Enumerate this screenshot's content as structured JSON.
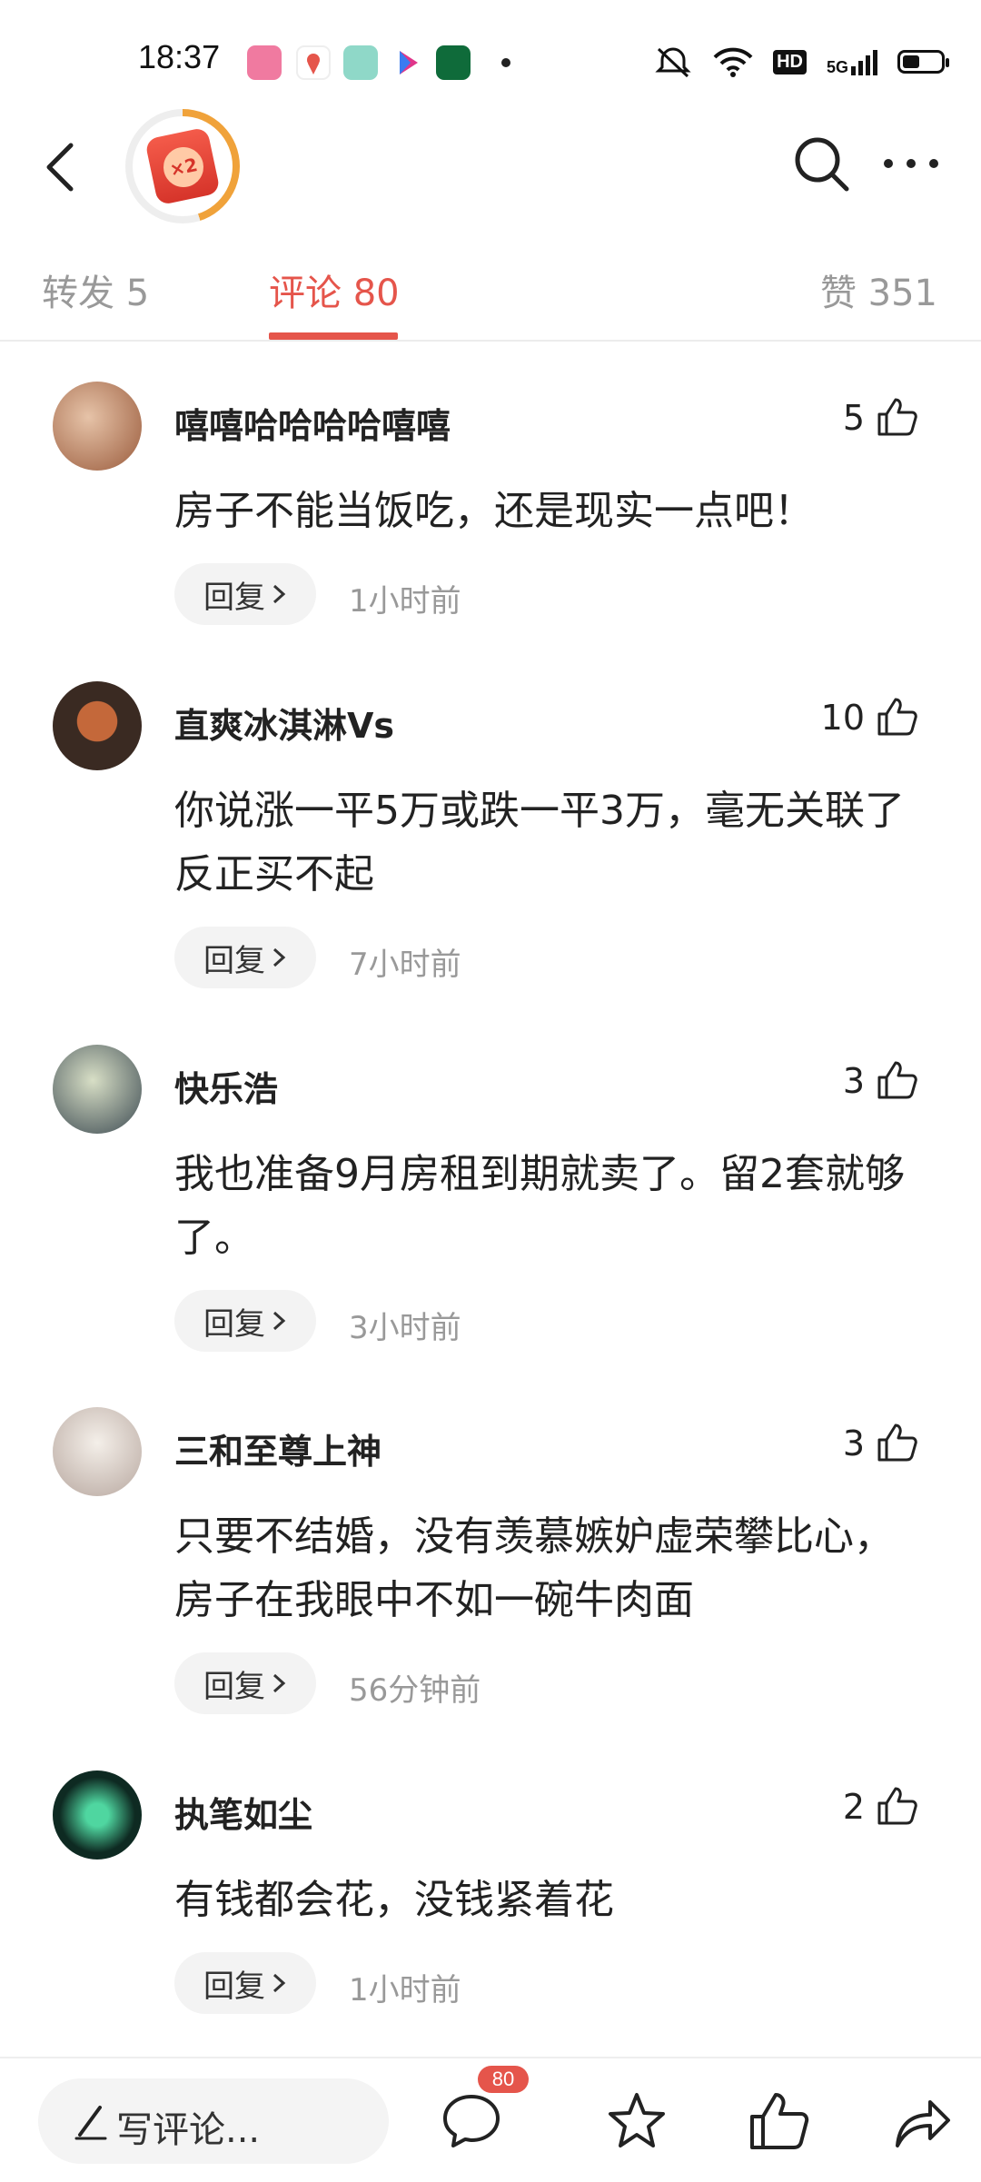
{
  "status_bar": {
    "time": "18:37",
    "hd": "HD",
    "network": "5G",
    "battery_level": 0.45
  },
  "tabs": [
    {
      "label": "转发 5"
    },
    {
      "label": "评论 80"
    },
    {
      "label": "赞 351"
    }
  ],
  "badge": {
    "text": "×2"
  },
  "comments": [
    {
      "name": "嘻嘻哈哈哈哈嘻嘻",
      "likes": "5",
      "text": "房子不能当饭吃，还是现实一点吧！",
      "time": "1小时前",
      "avatar_color": "#b47d5a"
    },
    {
      "name": "直爽冰淇淋Vs",
      "likes": "10",
      "text": "你说涨一平5万或跌一平3万，毫无关联了反正买不起",
      "time": "7小时前",
      "avatar_color": "#8a4a2a"
    },
    {
      "name": "快乐浩",
      "likes": "3",
      "text": "我也准备9月房租到期就卖了。留2套就够了。",
      "time": "3小时前",
      "avatar_color": "#5c6b74"
    },
    {
      "name": "三和至尊上神",
      "likes": "3",
      "text": "只要不结婚，没有羡慕嫉妒虚荣攀比心，房子在我眼中不如一碗牛肉面",
      "time": "56分钟前",
      "avatar_color": "#d8d2cc"
    },
    {
      "name": "执笔如尘",
      "likes": "2",
      "text": "有钱都会花，没钱紧着花",
      "time": "1小时前",
      "avatar_color": "#1f3a2e"
    }
  ],
  "reply_label": "回复",
  "bottom_bar": {
    "write_placeholder": "写评论...",
    "comment_count": "80"
  },
  "colors": {
    "accent": "#e5554b",
    "muted": "#999999"
  }
}
